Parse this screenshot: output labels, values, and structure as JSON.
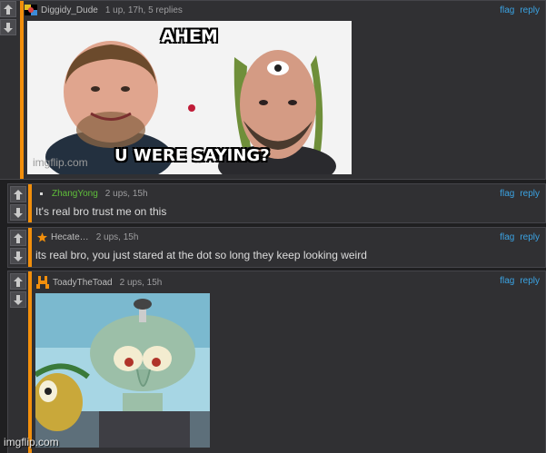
{
  "colors": {
    "accent": "#f28f0c",
    "link": "#3ba3e3",
    "panel": "#303033",
    "background": "#1f1f21"
  },
  "comments": [
    {
      "user": "Diggidy_Dude",
      "stats": "1 up, 17h, 5 replies",
      "flag": "flag",
      "reply": "reply",
      "image": {
        "top_text": "AHEM",
        "bottom_text": "U WERE SAYING?",
        "watermark": "imgflip.com"
      }
    },
    {
      "user": "ZhangYong",
      "user_color": "#5fbf3a",
      "stats": "2 ups, 15h",
      "flag": "flag",
      "reply": "reply",
      "text": "It's real bro trust me on this"
    },
    {
      "user": "Hecate…",
      "stats": "2 ups, 15h",
      "flag": "flag",
      "reply": "reply",
      "text": "its real bro, you just stared at the dot so long they keep looking weird"
    },
    {
      "user": "ToadyTheToad",
      "stats": "2 ups, 15h",
      "flag": "flag",
      "reply": "reply"
    }
  ],
  "page_watermark": "imgflip.com",
  "icons": {
    "upvote": "arrow-up-icon",
    "downvote": "arrow-down-icon"
  }
}
